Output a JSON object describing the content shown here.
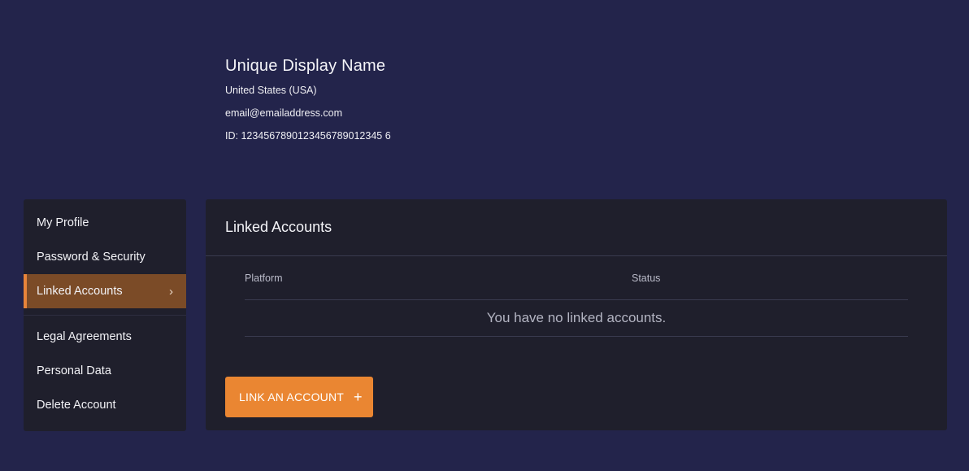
{
  "profile": {
    "display_name": "Unique Display Name",
    "country": "United States (USA)",
    "email": "email@emailaddress.com",
    "id": "ID: 1234567890123456789012345 6"
  },
  "sidebar": {
    "items": [
      {
        "label": "My Profile",
        "active": false
      },
      {
        "label": "Password & Security",
        "active": false
      },
      {
        "label": "Linked Accounts",
        "active": true
      },
      {
        "label": "Legal Agreements",
        "active": false
      },
      {
        "label": "Personal Data",
        "active": false
      },
      {
        "label": "Delete Account",
        "active": false
      }
    ],
    "active_chevron": "›"
  },
  "panel": {
    "title": "Linked Accounts",
    "columns": [
      "Platform",
      "Status"
    ],
    "empty_message": "You have no linked accounts.",
    "link_button_label": "LINK AN ACCOUNT",
    "link_button_icon": "plus-icon",
    "plus_glyph": "+"
  },
  "colors": {
    "background": "#23244b",
    "panel": "#1f1f2c",
    "accent": "#ea8632",
    "active_item": "#7b4b27"
  }
}
